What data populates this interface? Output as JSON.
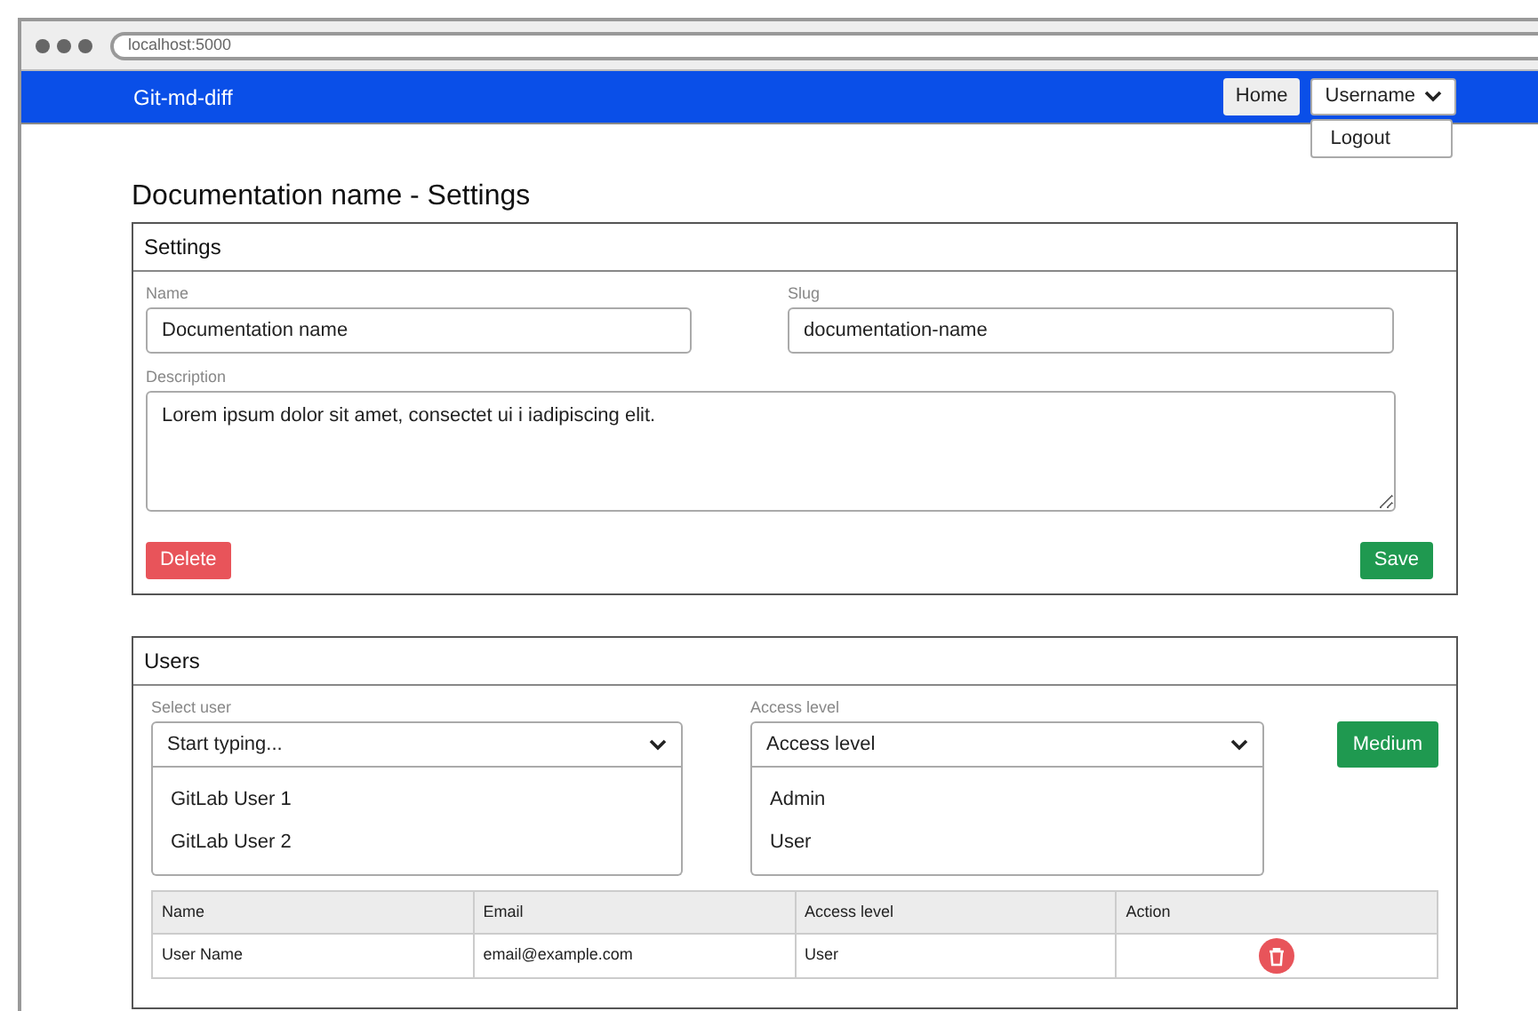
{
  "browser": {
    "address": "localhost:5000"
  },
  "navbar": {
    "brand": "Git-md-diff",
    "home": "Home",
    "user_menu": {
      "label": "Username",
      "expanded": true,
      "items": [
        "Logout"
      ]
    }
  },
  "page_title": "Documentation name - Settings",
  "settings": {
    "title": "Settings",
    "name": {
      "label": "Name",
      "value": "Documentation name"
    },
    "slug": {
      "label": "Slug",
      "value": "documentation-name"
    },
    "description": {
      "label": "Description",
      "value": "Lorem ipsum dolor sit amet, consectet ui i iadipiscing elit."
    },
    "delete": "Delete",
    "save": "Save"
  },
  "users": {
    "title": "Users",
    "select_user": {
      "label": "Select user",
      "placeholder": "Start typing...",
      "expanded": true,
      "options": [
        "GitLab User 1",
        "GitLab User 2"
      ]
    },
    "access_level": {
      "label": "Access level",
      "placeholder": "Access level",
      "expanded": true,
      "options": [
        "Admin",
        "User"
      ]
    },
    "add_button": "Medium",
    "table": {
      "columns": [
        "Name",
        "Email",
        "Access level",
        "Action"
      ],
      "rows": [
        {
          "name": "User Name",
          "email": "email@example.com",
          "access_level": "User"
        }
      ]
    }
  }
}
